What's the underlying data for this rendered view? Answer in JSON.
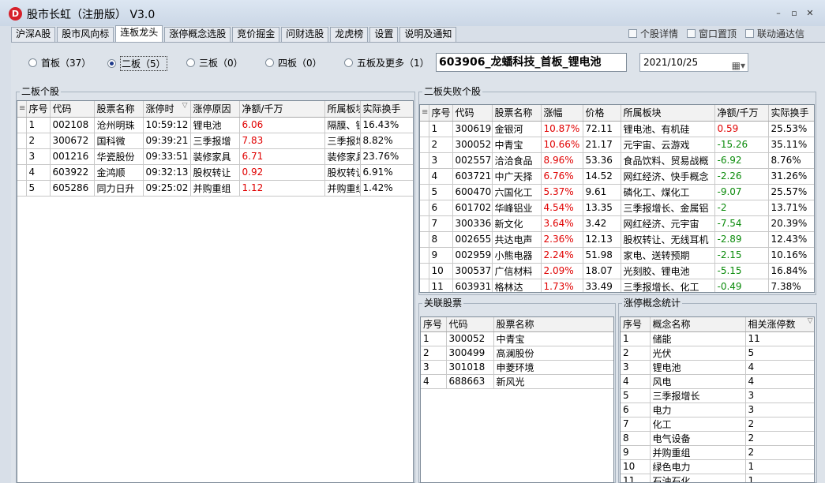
{
  "app": {
    "icon_letter": "D",
    "title": "股市长虹（注册版） V3.0",
    "window_controls": [
      "–",
      "▫",
      "✕"
    ]
  },
  "tabs": [
    {
      "label": "沪深A股"
    },
    {
      "label": "股市风向标"
    },
    {
      "label": "连板龙头"
    },
    {
      "label": "涨停概念选股"
    },
    {
      "label": "竞价掘金"
    },
    {
      "label": "问财选股"
    },
    {
      "label": "龙虎榜"
    },
    {
      "label": "设置"
    },
    {
      "label": "说明及通知"
    }
  ],
  "active_tab": "连板龙头",
  "options": [
    {
      "label": "个股详情"
    },
    {
      "label": "窗口置顶"
    },
    {
      "label": "联动通达信"
    }
  ],
  "radios": [
    {
      "label": "首板（37）",
      "selected": false
    },
    {
      "label": "二板（5）",
      "selected": true
    },
    {
      "label": "三板（0）",
      "selected": false
    },
    {
      "label": "四板（0）",
      "selected": false
    },
    {
      "label": "五板及更多（1）",
      "selected": false
    }
  ],
  "stock_info": "603906_龙蟠科技_首板_锂电池",
  "date": "2021/10/25",
  "colors": {
    "up": "#e00000",
    "down": "#0a8a0a"
  },
  "two_board": {
    "title": "二板个股",
    "columns": [
      "序号",
      "代码",
      "股票名称",
      "涨停时",
      "涨停原因",
      "净额/千万",
      "所属板块",
      "实际换手"
    ],
    "rows": [
      [
        "1",
        "002108",
        "沧州明珠",
        "10:59:12",
        "锂电池",
        "6.06",
        "隔膜、锂电池",
        "16.43%"
      ],
      [
        "2",
        "300672",
        "国科微",
        "09:39:21",
        "三季报增",
        "7.83",
        "三季报增长、芯片",
        "8.82%"
      ],
      [
        "3",
        "001216",
        "华瓷股份",
        "09:33:51",
        "装修家具",
        "6.71",
        "装修家具、次新股",
        "23.76%"
      ],
      [
        "4",
        "603922",
        "金鸿顺",
        "09:32:13",
        "股权转让",
        "0.92",
        "股权转让、新能源",
        "6.91%"
      ],
      [
        "5",
        "605286",
        "同力日升",
        "09:25:02",
        "并购重组",
        "1.12",
        "并购重组、储能",
        "1.42%"
      ]
    ]
  },
  "two_board_fail": {
    "title": "二板失败个股",
    "columns": [
      "序号",
      "代码",
      "股票名称",
      "涨幅",
      "价格",
      "所属板块",
      "净额/千万",
      "实际换手"
    ],
    "rows": [
      [
        "1",
        "300619",
        "金银河",
        "10.87%",
        "72.11",
        "锂电池、有机硅",
        "0.59",
        "25.53%"
      ],
      [
        "2",
        "300052",
        "中青宝",
        "10.66%",
        "21.17",
        "元宇宙、云游戏",
        "-15.26",
        "35.11%"
      ],
      [
        "3",
        "002557",
        "洽洽食品",
        "8.96%",
        "53.36",
        "食品饮料、贸易战概",
        "-6.92",
        "8.76%"
      ],
      [
        "4",
        "603721",
        "中广天择",
        "6.76%",
        "14.52",
        "网红经济、快手概念",
        "-2.26",
        "31.26%"
      ],
      [
        "5",
        "600470",
        "六国化工",
        "5.37%",
        "9.61",
        "磷化工、煤化工",
        "-9.07",
        "25.57%"
      ],
      [
        "6",
        "601702",
        "华峰铝业",
        "4.54%",
        "13.35",
        "三季报增长、金属铝",
        "-2",
        "13.71%"
      ],
      [
        "7",
        "300336",
        "新文化",
        "3.64%",
        "3.42",
        "网红经济、元宇宙",
        "-7.54",
        "20.39%"
      ],
      [
        "8",
        "002655",
        "共达电声",
        "2.36%",
        "12.13",
        "股权转让、无线耳机",
        "-2.89",
        "12.43%"
      ],
      [
        "9",
        "002959",
        "小熊电器",
        "2.24%",
        "51.98",
        "家电、送转预期",
        "-2.15",
        "10.16%"
      ],
      [
        "10",
        "300537",
        "广信材料",
        "2.09%",
        "18.07",
        "光刻胶、锂电池",
        "-5.15",
        "16.84%"
      ],
      [
        "11",
        "603931",
        "格林达",
        "1.73%",
        "33.49",
        "三季报增长、化工",
        "-0.49",
        "7.38%"
      ]
    ]
  },
  "related": {
    "title": "关联股票",
    "columns": [
      "序号",
      "代码",
      "股票名称"
    ],
    "rows": [
      [
        "1",
        "300052",
        "中青宝"
      ],
      [
        "2",
        "300499",
        "高澜股份"
      ],
      [
        "3",
        "301018",
        "申菱环境"
      ],
      [
        "4",
        "688663",
        "新风光"
      ]
    ]
  },
  "concepts": {
    "title": "涨停概念统计",
    "columns": [
      "序号",
      "概念名称",
      "相关涨停数"
    ],
    "rows": [
      [
        "1",
        "储能",
        "11"
      ],
      [
        "2",
        "光伏",
        "5"
      ],
      [
        "3",
        "锂电池",
        "4"
      ],
      [
        "4",
        "风电",
        "4"
      ],
      [
        "5",
        "三季报增长",
        "3"
      ],
      [
        "6",
        "电力",
        "3"
      ],
      [
        "7",
        "化工",
        "2"
      ],
      [
        "8",
        "电气设备",
        "2"
      ],
      [
        "9",
        "并购重组",
        "2"
      ],
      [
        "10",
        "绿色电力",
        "1"
      ],
      [
        "11",
        "石油石化",
        "1"
      ]
    ]
  }
}
